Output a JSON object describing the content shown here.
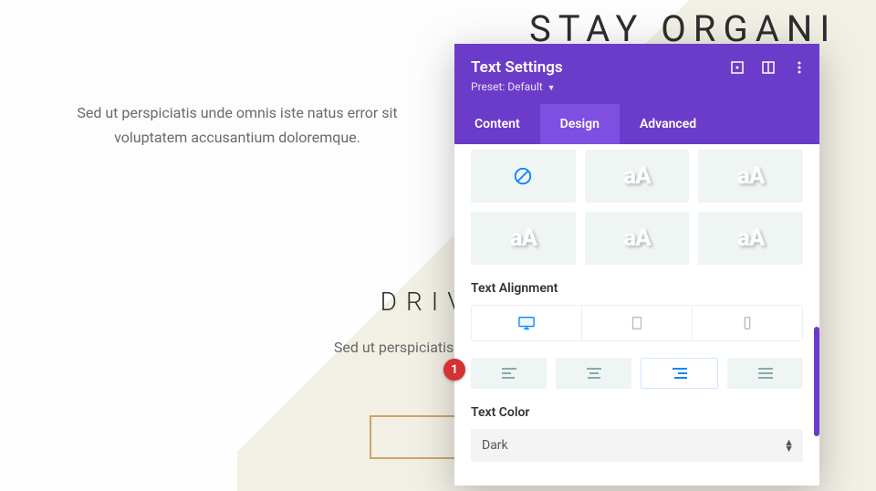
{
  "background": {
    "hero_title": "STAY ORGANI",
    "top_paragraph": "Sed ut perspiciatis unde omnis iste natus error sit voluptatem accusantium doloremque.",
    "mid_title": "DRIVE",
    "mid_paragraph": "Sed ut perspiciatis voluptatem a"
  },
  "panel": {
    "title": "Text Settings",
    "preset_label": "Preset:",
    "preset_value": "Default",
    "tabs": {
      "content": "Content",
      "design": "Design",
      "advanced": "Advanced",
      "active": "design"
    },
    "style_tiles": {
      "sample": "aA"
    },
    "alignment_label": "Text Alignment",
    "text_color_label": "Text Color",
    "text_color_value": "Dark"
  },
  "callouts": {
    "one": "1"
  }
}
